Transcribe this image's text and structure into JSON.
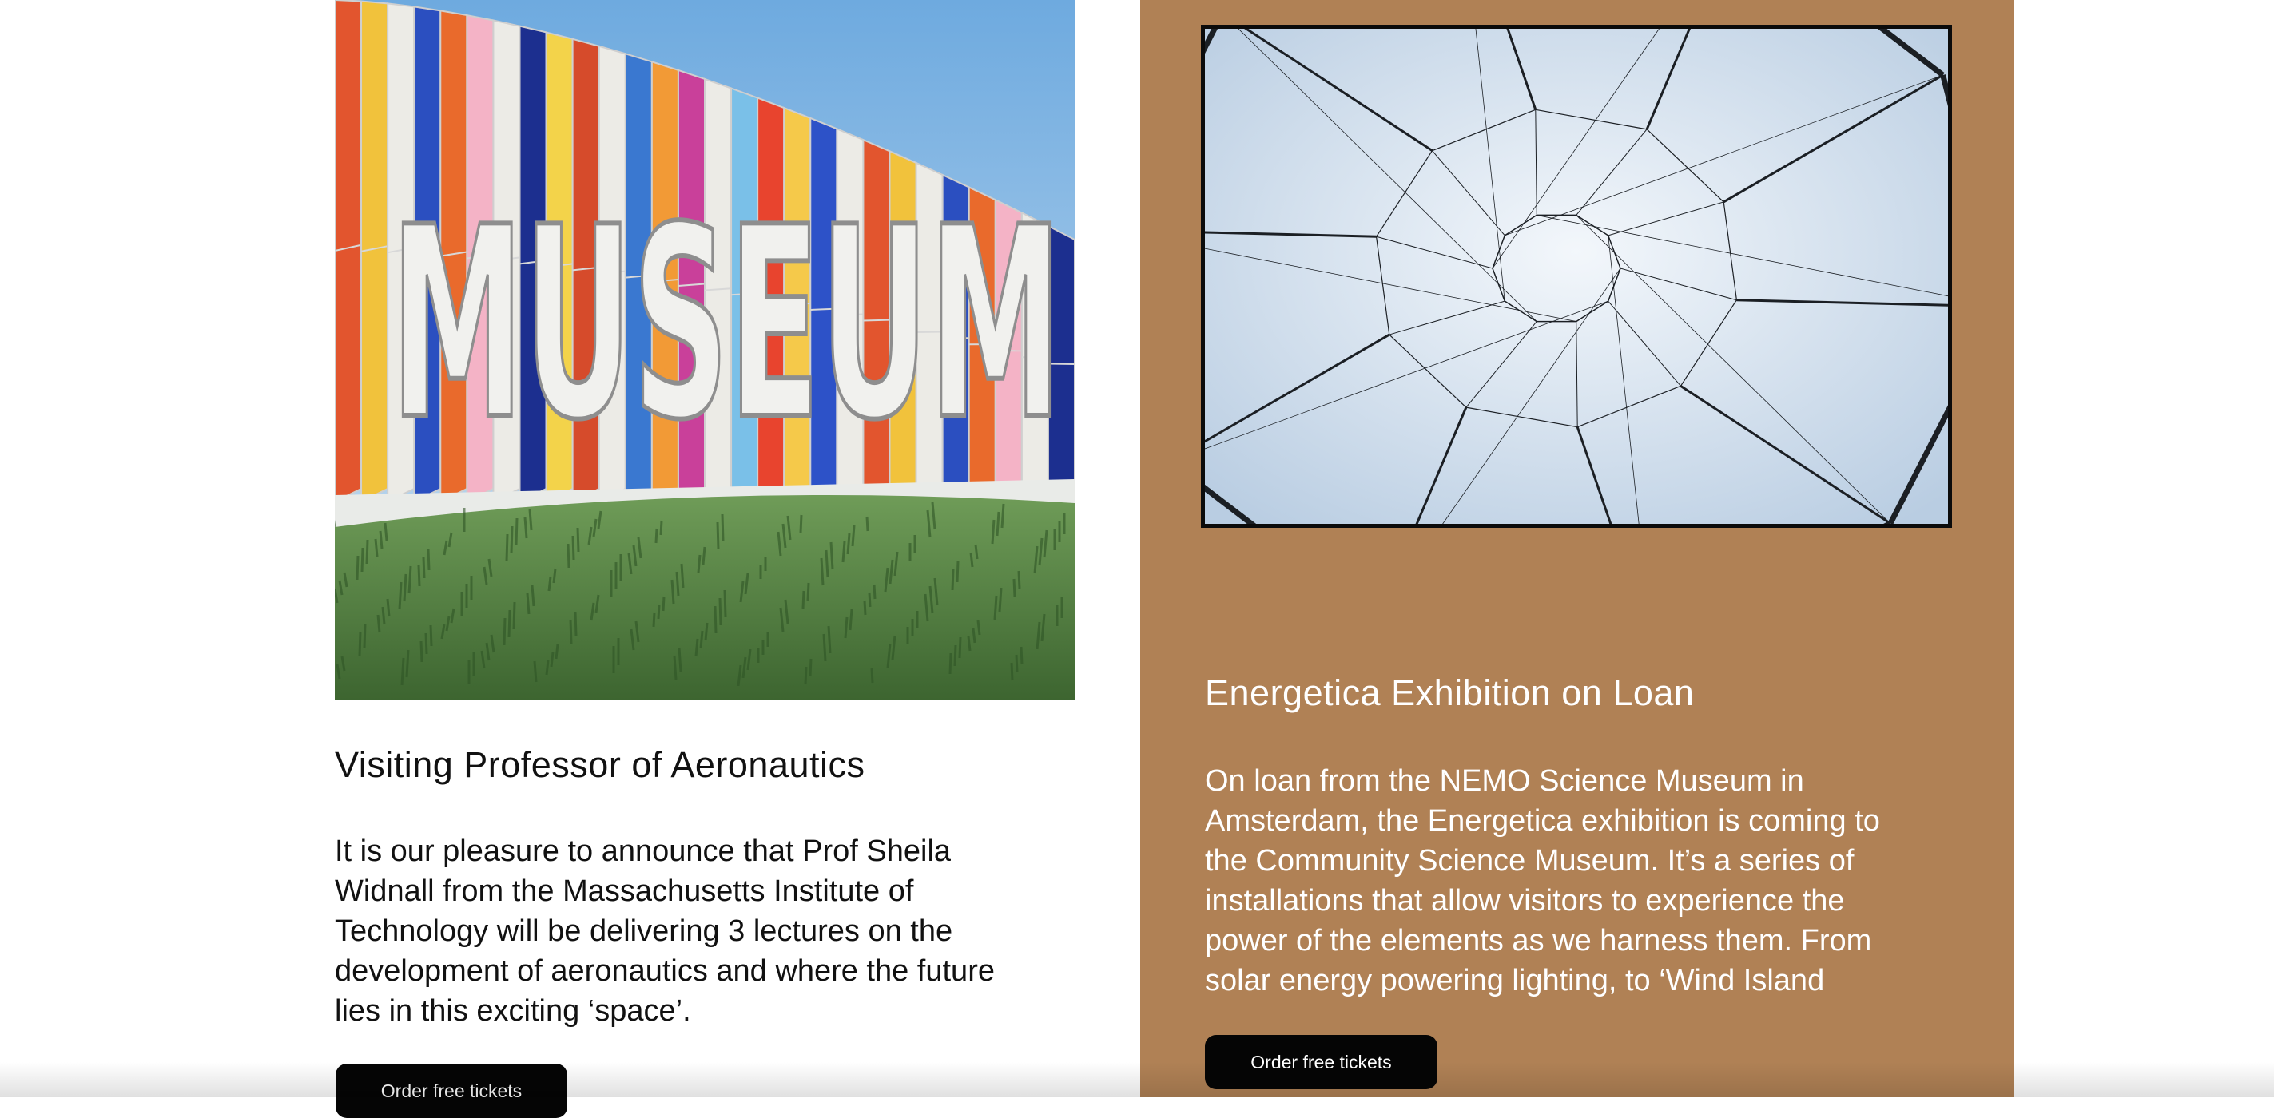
{
  "left_card": {
    "image_alt": "Colorful museum building facade",
    "title": "Visiting Professor of Aeronautics",
    "body": "It is our pleasure to announce that Prof Sheila Widnall from the Massachusetts Institute of Technology will be delivering 3 lectures on the development of aeronautics and where the future lies in this exciting ‘space’.",
    "button_label": "Order free tickets"
  },
  "right_card": {
    "image_alt": "Wire web installation against the sky",
    "title": "Energetica Exhibition on Loan",
    "body": "On loan from the NEMO Science Museum in Amsterdam, the Energetica exhibition is coming to the Community Science Museum. It’s a series of installations that allow visitors to experience the power of the elements as we harness them. From solar energy powering lighting, to ‘Wind Island",
    "button_label": "Order free tickets"
  },
  "colors": {
    "right_panel_background": "#b08155",
    "button_background": "#050505",
    "button_text": "#ffffff"
  }
}
